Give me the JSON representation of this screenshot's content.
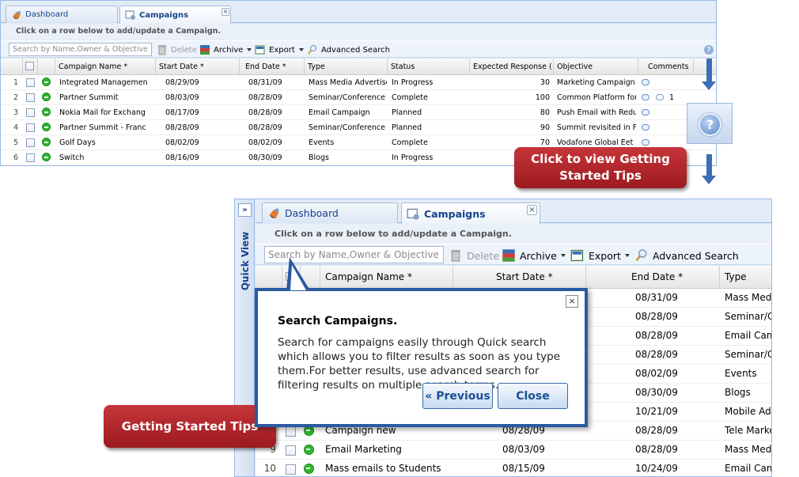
{
  "screen1": {
    "tabs": [
      {
        "label": "Dashboard"
      },
      {
        "label": "Campaigns"
      }
    ],
    "hint": "Click on a row below to add/update a Campaign.",
    "toolbar": {
      "search_placeholder": "Search by Name,Owner & Objective",
      "delete": "Delete",
      "archive": "Archive",
      "export": "Export",
      "advanced_search": "Advanced Search"
    },
    "columns": [
      "Campaign Name *",
      "Start Date *",
      "End Date *",
      "Type",
      "Status",
      "Expected Response (",
      "Objective",
      "Comments"
    ],
    "rows": [
      {
        "num": "1",
        "name": "Integrated Managemen",
        "start": "08/29/09",
        "end": "08/31/09",
        "type": "Mass Media Advertise",
        "status": "In Progress",
        "expected": "30",
        "objective": "Marketing Campaign fo",
        "comment_count": ""
      },
      {
        "num": "2",
        "name": "Partner Summit",
        "start": "08/03/09",
        "end": "08/28/09",
        "type": "Seminar/Conference",
        "status": "Complete",
        "expected": "100",
        "objective": "Common Platform for a",
        "comment_count": "1"
      },
      {
        "num": "3",
        "name": "Nokia Mail for Exchang",
        "start": "08/17/09",
        "end": "08/28/09",
        "type": "Email Campaign",
        "status": "Planned",
        "expected": "80",
        "objective": "Push Email with Reduc",
        "comment_count": ""
      },
      {
        "num": "4",
        "name": "Partner Summit - Franc",
        "start": "08/28/09",
        "end": "08/28/09",
        "type": "Seminar/Conference",
        "status": "Planned",
        "expected": "90",
        "objective": "Summit revisited in Fra",
        "comment_count": ""
      },
      {
        "num": "5",
        "name": "Golf Days",
        "start": "08/02/09",
        "end": "08/02/09",
        "type": "Events",
        "status": "Complete",
        "expected": "70",
        "objective": "Vodafone Global Eet",
        "comment_count": ""
      },
      {
        "num": "6",
        "name": "Switch",
        "start": "08/16/09",
        "end": "08/30/09",
        "type": "Blogs",
        "status": "In Progress",
        "expected": "",
        "objective": "",
        "comment_count": ""
      }
    ]
  },
  "callouts": {
    "help": "Click to view Getting Started Tips",
    "tips": "Getting Started Tips"
  },
  "screen2": {
    "quick_view": "Quick View",
    "quick_view_toggle": "»",
    "tabs": [
      {
        "label": "Dashboard"
      },
      {
        "label": "Campaigns"
      }
    ],
    "hint": "Click on a row below to add/update a Campaign.",
    "toolbar": {
      "search_placeholder": "Search by Name,Owner & Objective",
      "delete": "Delete",
      "archive": "Archive",
      "export": "Export",
      "advanced_search": "Advanced Search"
    },
    "columns": [
      "Campaign Name *",
      "Start Date *",
      "End Date *",
      "Type"
    ],
    "rows": [
      {
        "num": "",
        "name": "",
        "start": "",
        "end": "08/31/09",
        "type": "Mass Med"
      },
      {
        "num": "",
        "name": "",
        "start": "",
        "end": "08/28/09",
        "type": "Seminar/C"
      },
      {
        "num": "",
        "name": "",
        "start": "",
        "end": "08/28/09",
        "type": "Email Cam"
      },
      {
        "num": "",
        "name": "",
        "start": "",
        "end": "08/28/09",
        "type": "Seminar/C"
      },
      {
        "num": "",
        "name": "",
        "start": "",
        "end": "08/02/09",
        "type": "Events"
      },
      {
        "num": "",
        "name": "",
        "start": "",
        "end": "08/30/09",
        "type": "Blogs"
      },
      {
        "num": "",
        "name": "",
        "start": "",
        "end": "10/21/09",
        "type": "Mobile Adv"
      },
      {
        "num": "",
        "name": "Campaign new",
        "start": "08/28/09",
        "end": "08/28/09",
        "type": "Tele Marke"
      },
      {
        "num": "9",
        "name": "Email Marketing",
        "start": "08/03/09",
        "end": "08/28/09",
        "type": "Mass Med"
      },
      {
        "num": "10",
        "name": "Mass emails to Students",
        "start": "08/15/09",
        "end": "10/24/09",
        "type": "Email Cam"
      }
    ]
  },
  "tip": {
    "title": "Search Campaigns.",
    "body": "Search for campaigns easily through Quick search which allows you to filter results as soon as you type them.For better results, use advanced search for filtering results on multiple search terms.",
    "previous": "« Previous",
    "close": "Close",
    "close_x": "×"
  }
}
